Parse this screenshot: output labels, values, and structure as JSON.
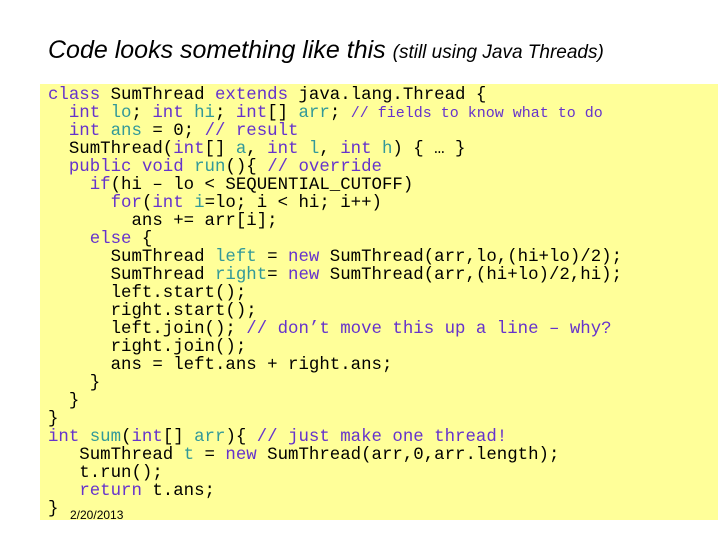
{
  "slide": {
    "title": "Code looks something like this",
    "subtitle": "(still using Java Threads)",
    "date": "2/20/2013"
  },
  "code": {
    "lines": [
      [
        [
          "kw",
          "class"
        ],
        [
          "t",
          " SumThread "
        ],
        [
          "kw",
          "extends"
        ],
        [
          "t",
          " java.lang.Thread {"
        ]
      ],
      [
        [
          "t",
          "  "
        ],
        [
          "kw",
          "int"
        ],
        [
          "t",
          " "
        ],
        [
          "var",
          "lo"
        ],
        [
          "t",
          "; "
        ],
        [
          "kw",
          "int"
        ],
        [
          "t",
          " "
        ],
        [
          "var",
          "hi"
        ],
        [
          "t",
          "; "
        ],
        [
          "kw",
          "int"
        ],
        [
          "t",
          "[] "
        ],
        [
          "var",
          "arr"
        ],
        [
          "t",
          "; "
        ],
        [
          "cms",
          "// fields to know what to do"
        ]
      ],
      [
        [
          "t",
          "  "
        ],
        [
          "kw",
          "int"
        ],
        [
          "t",
          " "
        ],
        [
          "var",
          "ans"
        ],
        [
          "t",
          " = 0; "
        ],
        [
          "cm",
          "// result"
        ]
      ],
      [
        [
          "t",
          "  SumThread("
        ],
        [
          "kw",
          "int"
        ],
        [
          "t",
          "[] "
        ],
        [
          "var",
          "a"
        ],
        [
          "t",
          ", "
        ],
        [
          "kw",
          "int"
        ],
        [
          "t",
          " "
        ],
        [
          "var",
          "l"
        ],
        [
          "t",
          ", "
        ],
        [
          "kw",
          "int"
        ],
        [
          "t",
          " "
        ],
        [
          "var",
          "h"
        ],
        [
          "t",
          ") { … }"
        ]
      ],
      [
        [
          "t",
          "  "
        ],
        [
          "kw",
          "public"
        ],
        [
          "t",
          " "
        ],
        [
          "kw",
          "void"
        ],
        [
          "t",
          " "
        ],
        [
          "var",
          "run"
        ],
        [
          "t",
          "(){ "
        ],
        [
          "cm",
          "// override"
        ]
      ],
      [
        [
          "t",
          "    "
        ],
        [
          "kw",
          "if"
        ],
        [
          "t",
          "(hi – lo < SEQUENTIAL_CUTOFF)"
        ]
      ],
      [
        [
          "t",
          "      "
        ],
        [
          "kw",
          "for"
        ],
        [
          "t",
          "("
        ],
        [
          "kw",
          "int"
        ],
        [
          "t",
          " "
        ],
        [
          "var",
          "i"
        ],
        [
          "t",
          "=lo; i < hi; i++)"
        ]
      ],
      [
        [
          "t",
          "        ans += arr[i];"
        ]
      ],
      [
        [
          "t",
          "    "
        ],
        [
          "kw",
          "else"
        ],
        [
          "t",
          " {"
        ]
      ],
      [
        [
          "t",
          "      SumThread "
        ],
        [
          "var",
          "left"
        ],
        [
          "t",
          " = "
        ],
        [
          "kw",
          "new"
        ],
        [
          "t",
          " SumThread(arr,lo,(hi+lo)/2);"
        ]
      ],
      [
        [
          "t",
          "      SumThread "
        ],
        [
          "var",
          "right"
        ],
        [
          "t",
          "= "
        ],
        [
          "kw",
          "new"
        ],
        [
          "t",
          " SumThread(arr,(hi+lo)/2,hi);"
        ]
      ],
      [
        [
          "t",
          "      left.start();"
        ]
      ],
      [
        [
          "t",
          "      right.start();"
        ]
      ],
      [
        [
          "t",
          "      left.join(); "
        ],
        [
          "cm",
          "// don’t move this up a line – why?"
        ]
      ],
      [
        [
          "t",
          "      right.join();"
        ]
      ],
      [
        [
          "t",
          "      ans = left.ans + right.ans;"
        ]
      ],
      [
        [
          "t",
          "    }"
        ]
      ],
      [
        [
          "t",
          "  }"
        ]
      ],
      [
        [
          "t",
          "}"
        ]
      ],
      [
        [
          "kw",
          "int"
        ],
        [
          "t",
          " "
        ],
        [
          "var",
          "sum"
        ],
        [
          "t",
          "("
        ],
        [
          "kw",
          "int"
        ],
        [
          "t",
          "[] "
        ],
        [
          "var",
          "arr"
        ],
        [
          "t",
          "){ "
        ],
        [
          "cm",
          "// just make one thread!"
        ]
      ],
      [
        [
          "t",
          "   SumThread "
        ],
        [
          "var",
          "t"
        ],
        [
          "t",
          " = "
        ],
        [
          "kw",
          "new"
        ],
        [
          "t",
          " SumThread(arr,0,arr.length);"
        ]
      ],
      [
        [
          "t",
          "   t.run();"
        ]
      ],
      [
        [
          "t",
          "   "
        ],
        [
          "kw",
          "return"
        ],
        [
          "t",
          " t.ans;"
        ]
      ],
      [
        [
          "t",
          "}"
        ]
      ]
    ]
  },
  "colors": {
    "keyword": "#6633cc",
    "identifier": "#339999",
    "comment": "#6633cc",
    "code_background": "#ffff99"
  }
}
